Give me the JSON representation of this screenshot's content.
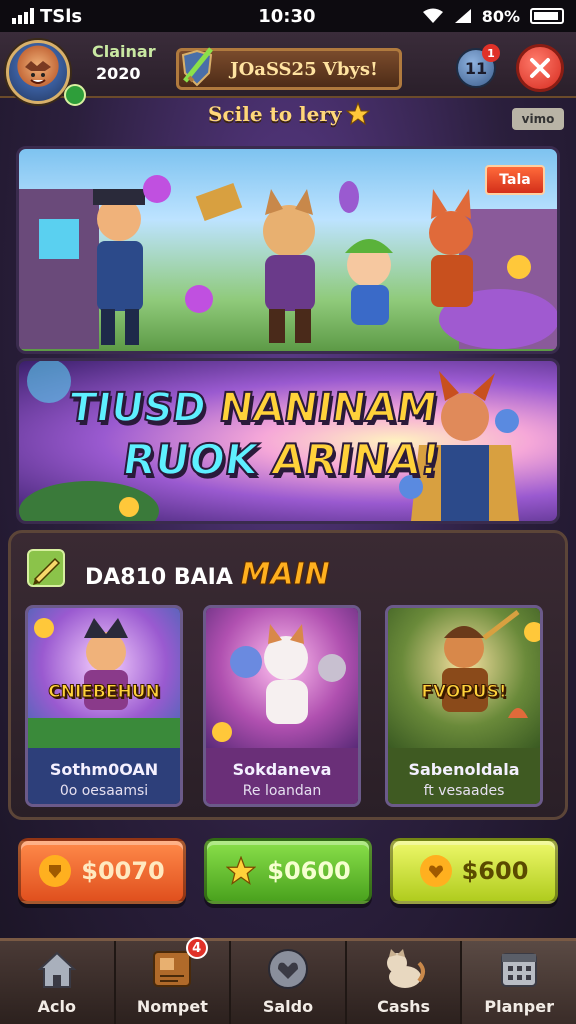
{
  "status_bar": {
    "carrier": "TSls",
    "time": "10:30",
    "battery_text": "80%"
  },
  "header": {
    "player_name": "Clainar",
    "player_score": "2020",
    "title": "JOaSS25 Vbys!",
    "notification_label": "11",
    "notification_count": "1"
  },
  "subtitle": {
    "text": "Scile to lery",
    "version": "vimo"
  },
  "hero": {
    "tag": "Tala"
  },
  "promo": {
    "line1_a": "TIUSD ",
    "line1_b": "NANINAM",
    "line2_a": "RUOK ",
    "line2_b": "ARINA!"
  },
  "daily": {
    "title": "DA810 BAIA ",
    "title_highlight": "MAIN",
    "cards": [
      {
        "banner": "CNIEBEHUN",
        "name": "Sothm0OAN",
        "sub": "0o oesaamsi",
        "label_bg": "#2d3f7a"
      },
      {
        "banner": "",
        "name": "Sokdaneva",
        "sub": "Re loandan",
        "label_bg": "#6a2f78"
      },
      {
        "banner": "FVOPUS!",
        "name": "Sabenoldala",
        "sub": "ft vesaades",
        "label_bg": "#3f5a22"
      }
    ]
  },
  "prices": [
    {
      "label": "$0070",
      "color": "#f0641e",
      "coin_color": "#ffb01f"
    },
    {
      "label": "$0600",
      "color": "#62c22a",
      "coin_color": "#ffd23a"
    },
    {
      "label": "$600",
      "color": "#c6e02a",
      "coin_color": "#ffb01f"
    }
  ],
  "nav": [
    {
      "label": "Aclo",
      "icon": "home-icon"
    },
    {
      "label": "Nompet",
      "icon": "board-icon",
      "badge": "4"
    },
    {
      "label": "Saldo",
      "icon": "heart-shield-icon"
    },
    {
      "label": "Cashs",
      "icon": "cat-icon"
    },
    {
      "label": "Planper",
      "icon": "calendar-icon"
    }
  ]
}
